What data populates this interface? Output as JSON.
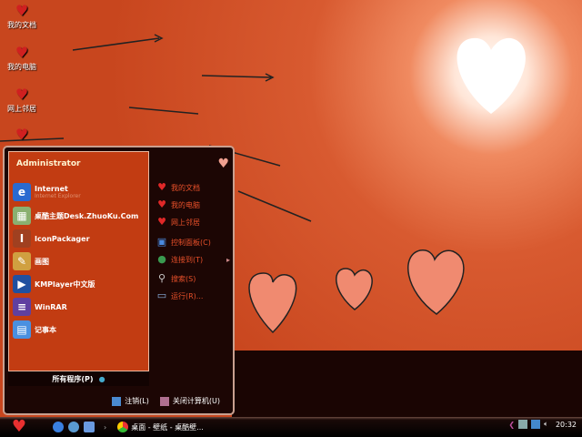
{
  "desktop": {
    "icons": [
      {
        "label": "我的文档"
      },
      {
        "label": "我的电脑"
      },
      {
        "label": "网上邻居"
      },
      {
        "label": ""
      }
    ]
  },
  "start_menu": {
    "username": "Administrator",
    "pinned": [
      {
        "label": "Internet",
        "sub": "Internet Explorer",
        "icon": "ie-icon"
      },
      {
        "label": "桌酷主题Desk.ZhuoKu.Com",
        "icon": "theme-icon"
      },
      {
        "label": "IconPackager",
        "icon": "iconpackager-icon"
      },
      {
        "label": "画图",
        "icon": "paint-icon"
      },
      {
        "label": "KMPlayer中文版",
        "icon": "kmplayer-icon"
      },
      {
        "label": "WinRAR",
        "icon": "winrar-icon"
      },
      {
        "label": "记事本",
        "icon": "notepad-icon"
      }
    ],
    "all_programs": "所有程序(P)",
    "places": [
      {
        "label": "我的文档"
      },
      {
        "label": "我的电脑"
      },
      {
        "label": "网上邻居"
      },
      {
        "label": "控制面板(C)"
      },
      {
        "label": "连接到(T)"
      },
      {
        "label": "搜索(S)"
      },
      {
        "label": "运行(R)..."
      }
    ],
    "logoff": "注销(L)",
    "shutdown": "关闭计算机(U)"
  },
  "taskbar": {
    "task": "桌面 - 壁纸 - 桌酷壁...",
    "clock": "20:32"
  },
  "colors": {
    "menu_left": "#c23c12",
    "menu_dark": "#1c0604",
    "accent": "#e8502a"
  }
}
